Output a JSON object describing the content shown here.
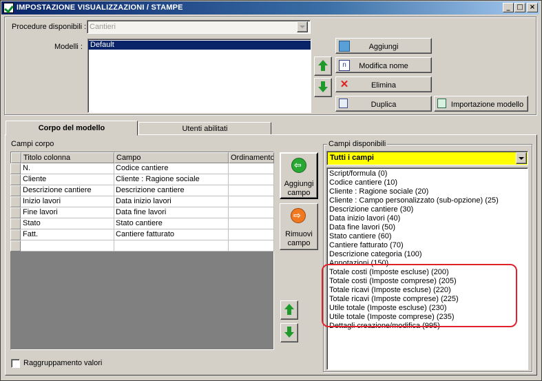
{
  "window": {
    "title": "IMPOSTAZIONE VISUALIZZAZIONI / STAMPE",
    "min": "_",
    "max": "□",
    "close": "×"
  },
  "top": {
    "procedure_label": "Procedure disponibili :",
    "procedure_value": "Cantieri",
    "models_label": "Modelli :",
    "models": [
      "Default"
    ],
    "buttons": {
      "aggiungi": "Aggiungi",
      "modifica": "Modifica nome",
      "elimina": "Elimina",
      "duplica": "Duplica",
      "importazione": "Importazione modello"
    }
  },
  "tabs": [
    {
      "label": "Corpo del modello"
    },
    {
      "label": "Utenti abilitati"
    }
  ],
  "campi_corpo": {
    "title": "Campi corpo",
    "headers": [
      "Titolo colonna",
      "Campo",
      "Ordinamento"
    ],
    "rows": [
      [
        "N.",
        "Codice cantiere",
        ""
      ],
      [
        "Cliente",
        "Cliente : Ragione sociale",
        ""
      ],
      [
        "Descrizione cantiere",
        "Descrizione cantiere",
        ""
      ],
      [
        "Inizio lavori",
        "Data inizio lavori",
        ""
      ],
      [
        "Fine lavori",
        "Data fine lavori",
        ""
      ],
      [
        "Stato",
        "Stato cantiere",
        ""
      ],
      [
        "Fatt.",
        "Cantiere fatturato",
        ""
      ],
      [
        "",
        "",
        ""
      ]
    ]
  },
  "middle_buttons": {
    "aggiungi_campo": [
      "Aggiungi",
      "campo"
    ],
    "rimuovi_campo": [
      "Rimuovi",
      "campo"
    ]
  },
  "campi_disponibili": {
    "title": "Campi disponibili",
    "filter": "Tutti i campi",
    "items": [
      "Script/formula (0)",
      "Codice cantiere (10)",
      "Cliente : Ragione sociale (20)",
      "Cliente : Campo personalizzato (sub-opzione) (25)",
      "Descrizione cantiere (30)",
      "Data inizio lavori (40)",
      "Data fine lavori (50)",
      "Stato cantiere (60)",
      "Cantiere fatturato (70)",
      "Descrizione categoria (100)",
      "Annotazioni (150)",
      "Totale costi (Imposte escluse) (200)",
      "Totale costi (Imposte comprese) (205)",
      "Totale ricavi (Imposte escluse) (220)",
      "Totale ricavi (Imposte comprese) (225)",
      "Utile totale (Imposte escluse) (230)",
      "Utile totale (Imposte comprese) (235)",
      "Dettagli creazione/modifica (995)"
    ]
  },
  "raggruppamento": "Raggruppamento valori",
  "colors": {
    "highlight": "#e0202a",
    "selection": "#0a246a",
    "filter_bg": "#ffff00"
  }
}
